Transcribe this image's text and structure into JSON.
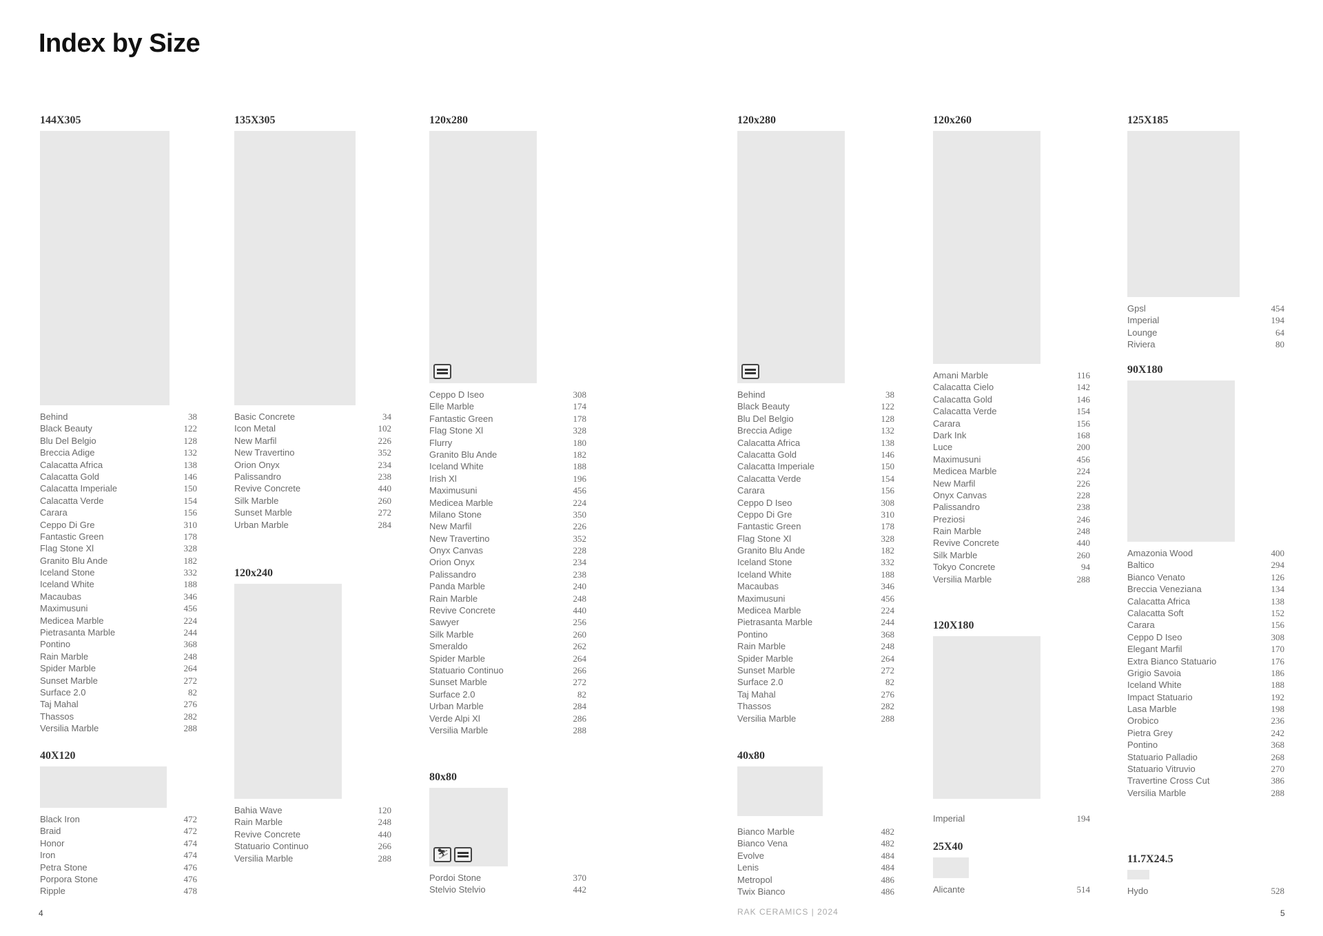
{
  "page_title": "Index by Size",
  "footer": {
    "page_left": "4",
    "page_right": "5",
    "brand": "RAK CERAMICS | 2024"
  },
  "sections": {
    "s144x305": {
      "size": "144X305",
      "items": [
        [
          "Behind",
          "38"
        ],
        [
          "Black Beauty",
          "122"
        ],
        [
          "Blu Del Belgio",
          "128"
        ],
        [
          "Breccia Adige",
          "132"
        ],
        [
          "Calacatta Africa",
          "138"
        ],
        [
          "Calacatta Gold",
          "146"
        ],
        [
          "Calacatta Imperiale",
          "150"
        ],
        [
          "Calacatta Verde",
          "154"
        ],
        [
          "Carara",
          "156"
        ],
        [
          "Ceppo Di Gre",
          "310"
        ],
        [
          "Fantastic Green",
          "178"
        ],
        [
          "Flag Stone Xl",
          "328"
        ],
        [
          "Granito Blu Ande",
          "182"
        ],
        [
          "Iceland Stone",
          "332"
        ],
        [
          "Iceland White",
          "188"
        ],
        [
          "Macaubas",
          "346"
        ],
        [
          "Maximusuni",
          "456"
        ],
        [
          "Medicea Marble",
          "224"
        ],
        [
          "Pietrasanta Marble",
          "244"
        ],
        [
          "Pontino",
          "368"
        ],
        [
          "Rain Marble",
          "248"
        ],
        [
          "Spider Marble",
          "264"
        ],
        [
          "Sunset Marble",
          "272"
        ],
        [
          "Surface 2.0",
          "82"
        ],
        [
          "Taj Mahal",
          "276"
        ],
        [
          "Thassos",
          "282"
        ],
        [
          "Versilia Marble",
          "288"
        ]
      ]
    },
    "s40x120": {
      "size": "40X120",
      "items": [
        [
          "Black Iron",
          "472"
        ],
        [
          "Braid",
          "472"
        ],
        [
          "Honor",
          "474"
        ],
        [
          "Iron",
          "474"
        ],
        [
          "Petra Stone",
          "476"
        ],
        [
          "Porpora Stone",
          "476"
        ],
        [
          "Ripple",
          "478"
        ]
      ]
    },
    "s135x305": {
      "size": "135X305",
      "items": [
        [
          "Basic Concrete",
          "34"
        ],
        [
          "Icon Metal",
          "102"
        ],
        [
          "New Marfil",
          "226"
        ],
        [
          "New Travertino",
          "352"
        ],
        [
          "Orion Onyx",
          "234"
        ],
        [
          "Palissandro",
          "238"
        ],
        [
          "Revive Concrete",
          "440"
        ],
        [
          "Silk Marble",
          "260"
        ],
        [
          "Sunset Marble",
          "272"
        ],
        [
          "Urban Marble",
          "284"
        ]
      ]
    },
    "s120x240": {
      "size": "120x240",
      "items": [
        [
          "Bahia Wave",
          "120"
        ],
        [
          "Rain Marble",
          "248"
        ],
        [
          "Revive Concrete",
          "440"
        ],
        [
          "Statuario Continuo",
          "266"
        ],
        [
          "Versilia Marble",
          "288"
        ]
      ]
    },
    "s120x280a": {
      "size": "120x280",
      "icons": [
        "thickness-icon"
      ],
      "items": [
        [
          "Ceppo D Iseo",
          "308"
        ],
        [
          "Elle Marble",
          "174"
        ],
        [
          "Fantastic Green",
          "178"
        ],
        [
          "Flag Stone Xl",
          "328"
        ],
        [
          "Flurry",
          "180"
        ],
        [
          "Granito Blu Ande",
          "182"
        ],
        [
          "Iceland White",
          "188"
        ],
        [
          "Irish Xl",
          "196"
        ],
        [
          "Maximusuni",
          "456"
        ],
        [
          "Medicea Marble",
          "224"
        ],
        [
          "Milano Stone",
          "350"
        ],
        [
          "New Marfil",
          "226"
        ],
        [
          "New Travertino",
          "352"
        ],
        [
          "Onyx Canvas",
          "228"
        ],
        [
          "Orion Onyx",
          "234"
        ],
        [
          "Palissandro",
          "238"
        ],
        [
          "Panda Marble",
          "240"
        ],
        [
          "Rain Marble",
          "248"
        ],
        [
          "Revive Concrete",
          "440"
        ],
        [
          "Sawyer",
          "256"
        ],
        [
          "Silk Marble",
          "260"
        ],
        [
          "Smeraldo",
          "262"
        ],
        [
          "Spider Marble",
          "264"
        ],
        [
          "Statuario Continuo",
          "266"
        ],
        [
          "Sunset Marble",
          "272"
        ],
        [
          "Surface 2.0",
          "82"
        ],
        [
          "Urban Marble",
          "284"
        ],
        [
          "Verde Alpi Xl",
          "286"
        ],
        [
          "Versilia Marble",
          "288"
        ]
      ]
    },
    "s80x80": {
      "size": "80x80",
      "icons": [
        "outdoor-icon",
        "thickness-icon"
      ],
      "items": [
        [
          "Pordoi Stone",
          "370"
        ],
        [
          "Stelvio Stelvio",
          "442"
        ]
      ]
    },
    "s120x280b": {
      "size": "120x280",
      "icons": [
        "thickness-icon"
      ],
      "items": [
        [
          "Behind",
          "38"
        ],
        [
          "Black Beauty",
          "122"
        ],
        [
          "Blu Del Belgio",
          "128"
        ],
        [
          "Breccia Adige",
          "132"
        ],
        [
          "Calacatta Africa",
          "138"
        ],
        [
          "Calacatta Gold",
          "146"
        ],
        [
          "Calacatta Imperiale",
          "150"
        ],
        [
          "Calacatta Verde",
          "154"
        ],
        [
          "Carara",
          "156"
        ],
        [
          "Ceppo D Iseo",
          "308"
        ],
        [
          "Ceppo Di Gre",
          "310"
        ],
        [
          "Fantastic Green",
          "178"
        ],
        [
          "Flag Stone Xl",
          "328"
        ],
        [
          "Granito Blu Ande",
          "182"
        ],
        [
          "Iceland Stone",
          "332"
        ],
        [
          "Iceland White",
          "188"
        ],
        [
          "Macaubas",
          "346"
        ],
        [
          "Maximusuni",
          "456"
        ],
        [
          "Medicea Marble",
          "224"
        ],
        [
          "Pietrasanta Marble",
          "244"
        ],
        [
          "Pontino",
          "368"
        ],
        [
          "Rain Marble",
          "248"
        ],
        [
          "Spider Marble",
          "264"
        ],
        [
          "Sunset Marble",
          "272"
        ],
        [
          "Surface 2.0",
          "82"
        ],
        [
          "Taj Mahal",
          "276"
        ],
        [
          "Thassos",
          "282"
        ],
        [
          "Versilia Marble",
          "288"
        ]
      ]
    },
    "s40x80": {
      "size": "40x80",
      "items": [
        [
          "Bianco Marble",
          "482"
        ],
        [
          "Bianco Vena",
          "482"
        ],
        [
          "Evolve",
          "484"
        ],
        [
          "Lenis",
          "484"
        ],
        [
          "Metropol",
          "486"
        ],
        [
          "Twix Bianco",
          "486"
        ]
      ]
    },
    "s120x260": {
      "size": "120x260",
      "items": [
        [
          "Amani Marble",
          "116"
        ],
        [
          "Calacatta Cielo",
          "142"
        ],
        [
          "Calacatta Gold",
          "146"
        ],
        [
          "Calacatta Verde",
          "154"
        ],
        [
          "Carara",
          "156"
        ],
        [
          "Dark Ink",
          "168"
        ],
        [
          "Luce",
          "200"
        ],
        [
          "Maximusuni",
          "456"
        ],
        [
          "Medicea Marble",
          "224"
        ],
        [
          "New Marfil",
          "226"
        ],
        [
          "Onyx Canvas",
          "228"
        ],
        [
          "Palissandro",
          "238"
        ],
        [
          "Preziosi",
          "246"
        ],
        [
          "Rain Marble",
          "248"
        ],
        [
          "Revive Concrete",
          "440"
        ],
        [
          "Silk Marble",
          "260"
        ],
        [
          "Tokyo Concrete",
          "94"
        ],
        [
          "Versilia Marble",
          "288"
        ]
      ]
    },
    "s120x180": {
      "size": "120X180",
      "items": [
        [
          "Imperial",
          "194"
        ]
      ]
    },
    "s25x40": {
      "size": "25X40",
      "items": [
        [
          "Alicante",
          "514"
        ]
      ]
    },
    "s125x185": {
      "size": "125X185",
      "items": [
        [
          "Gpsl",
          "454"
        ],
        [
          "Imperial",
          "194"
        ],
        [
          "Lounge",
          "64"
        ],
        [
          "Riviera",
          "80"
        ]
      ]
    },
    "s90x180": {
      "size": "90X180",
      "items": [
        [
          "Amazonia Wood",
          "400"
        ],
        [
          "Baltico",
          "294"
        ],
        [
          "Bianco Venato",
          "126"
        ],
        [
          "Breccia Veneziana",
          "134"
        ],
        [
          "Calacatta Africa",
          "138"
        ],
        [
          "Calacatta Soft",
          "152"
        ],
        [
          "Carara",
          "156"
        ],
        [
          "Ceppo D Iseo",
          "308"
        ],
        [
          "Elegant Marfil",
          "170"
        ],
        [
          "Extra Bianco Statuario",
          "176"
        ],
        [
          "Grigio Savoia",
          "186"
        ],
        [
          "Iceland White",
          "188"
        ],
        [
          "Impact Statuario",
          "192"
        ],
        [
          "Lasa Marble",
          "198"
        ],
        [
          "Orobico",
          "236"
        ],
        [
          "Pietra Grey",
          "242"
        ],
        [
          "Pontino",
          "368"
        ],
        [
          "Statuario Palladio",
          "268"
        ],
        [
          "Statuario Vitruvio",
          "270"
        ],
        [
          "Travertine Cross Cut",
          "386"
        ],
        [
          "Versilia Marble",
          "288"
        ]
      ]
    },
    "s11x24": {
      "size": "11.7X24.5",
      "items": [
        [
          "Hydo",
          "528"
        ]
      ]
    }
  }
}
